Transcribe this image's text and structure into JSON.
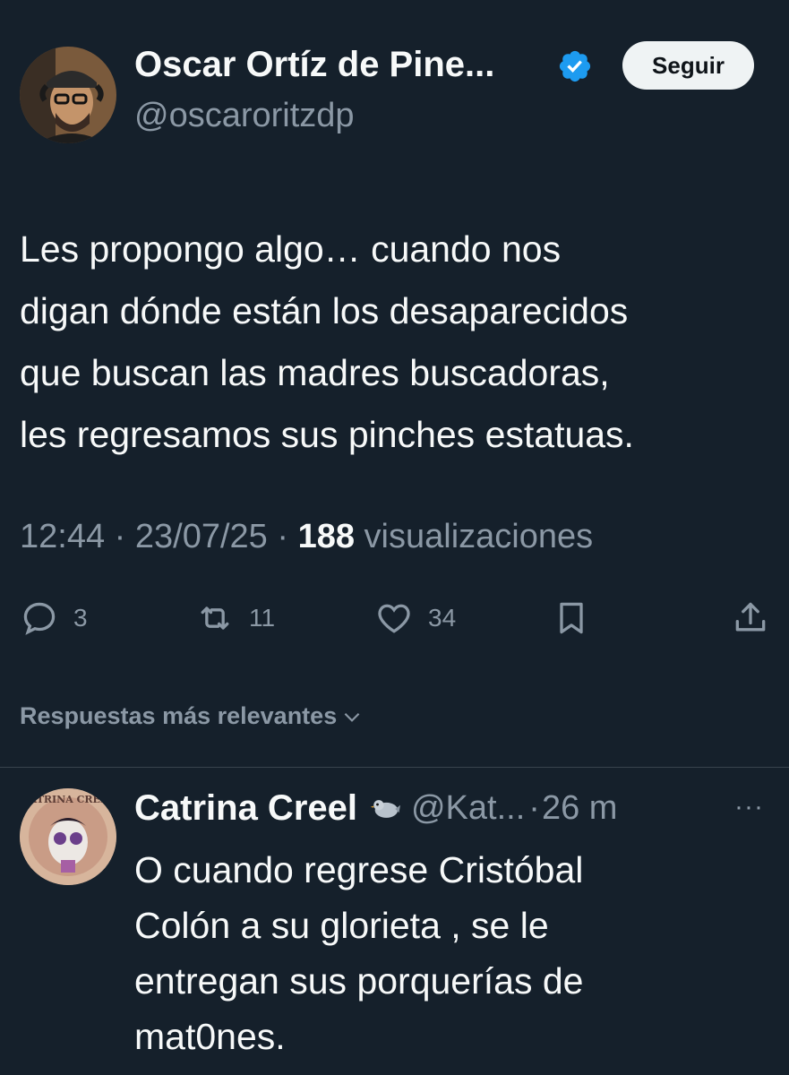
{
  "tweet": {
    "display_name": "Oscar Ortíz de Pine...",
    "handle": "@oscaroritzdp",
    "follow_label": "Seguir",
    "text": "Les propongo algo… cuando nos\ndigan dónde están los desaparecidos\nque buscan las madres buscadoras,\nles regresamos sus pinches estatuas.",
    "time": "12:44",
    "separator": "·",
    "date": "23/07/25",
    "views_count": "188",
    "views_label": "visualizaciones",
    "verified_icon": "verified-badge-icon",
    "colors": {
      "background": "#15202b",
      "text": "#f7f9f9",
      "secondary": "#8b98a5",
      "verified": "#1d9bf0"
    }
  },
  "actions": {
    "replies": "3",
    "retweets": "11",
    "likes": "34"
  },
  "sort_label": "Respuestas más relevantes",
  "reply": {
    "display_name": "Catrina Creel",
    "avatar_text": "CATRINA CREEL",
    "handle": "@Kat...",
    "separator": "·",
    "time": "26 m",
    "more": "···",
    "text": "O cuando regrese Cristóbal\nColón a su glorieta , se le\nentregan sus porquerías de\nmat0nes."
  }
}
